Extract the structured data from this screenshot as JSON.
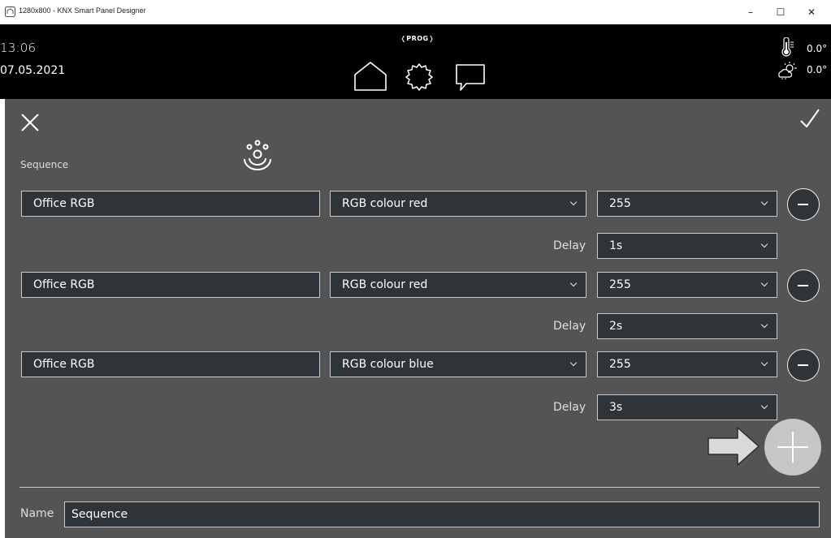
{
  "window": {
    "title": "1280x800 - KNX Smart Panel Designer",
    "icon": "app-icon",
    "minimize_glyph": "–",
    "maximize_glyph": "☐",
    "close_glyph": "✕"
  },
  "topbar": {
    "time": "13:06",
    "date": "07.05.2021",
    "prog_badge": "❬PROG❭",
    "nav": [
      {
        "name": "home-icon"
      },
      {
        "name": "settings-icon"
      },
      {
        "name": "chat-icon"
      }
    ],
    "temperature": "0.0°",
    "weather": "0.0°"
  },
  "editor": {
    "section_label": "Sequence",
    "steps": [
      {
        "object": "Office RGB",
        "function": "RGB colour red",
        "value": "255",
        "delay": "1s"
      },
      {
        "object": "Office RGB",
        "function": "RGB colour red",
        "value": "255",
        "delay": "2s"
      },
      {
        "object": "Office RGB",
        "function": "RGB colour blue",
        "value": "255",
        "delay": "3s"
      }
    ],
    "delay_label": "Delay",
    "name_label": "Name",
    "name_value": "Sequence"
  },
  "colors": {
    "panel_bg": "#545454",
    "field_bg": "#2f3438",
    "topbar_bg": "#000000",
    "add_button": "#c6c6c6"
  }
}
